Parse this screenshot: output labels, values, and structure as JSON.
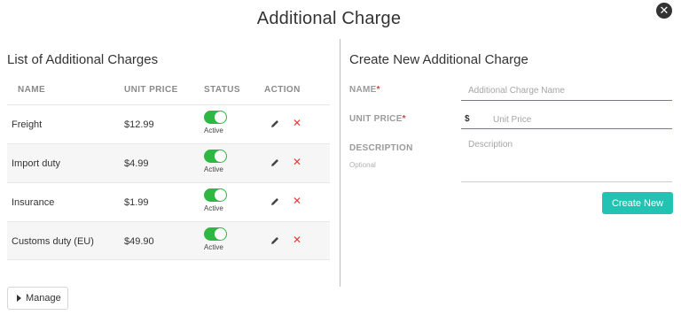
{
  "modal": {
    "title": "Additional Charge",
    "close_icon": "close-icon"
  },
  "left": {
    "title": "List of Additional Charges",
    "columns": [
      "NAME",
      "UNIT PRICE",
      "STATUS",
      "ACTION"
    ],
    "rows": [
      {
        "name": "Freight",
        "price": "$12.99",
        "status": "Active"
      },
      {
        "name": "Import duty",
        "price": "$4.99",
        "status": "Active"
      },
      {
        "name": "Insurance",
        "price": "$1.99",
        "status": "Active"
      },
      {
        "name": "Customs duty (EU)",
        "price": "$49.90",
        "status": "Active"
      }
    ]
  },
  "right": {
    "title": "Create New Additional Charge",
    "name_label": "NAME",
    "price_label": "UNIT PRICE",
    "description_label": "DESCRIPTION",
    "optional_text": "Optional",
    "required_mark": "*",
    "name_placeholder": "Additional Charge Name",
    "currency_symbol": "$",
    "price_placeholder": "Unit Price",
    "description_placeholder": "Description",
    "create_button": "Create New"
  },
  "footer": {
    "manage_button": "Manage"
  },
  "colors": {
    "accent": "#22c3b2",
    "toggle_on": "#2fb744",
    "error": "#d9534f"
  }
}
